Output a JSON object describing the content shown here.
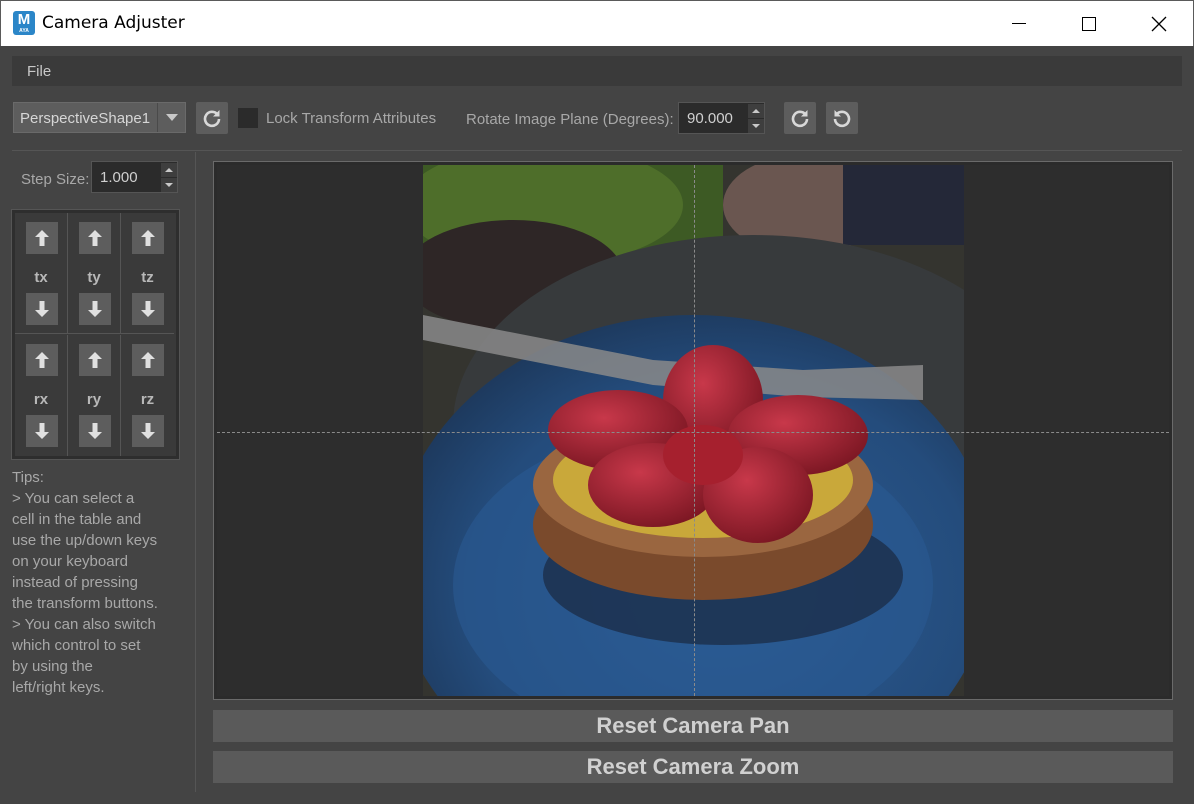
{
  "window": {
    "title": "Camera Adjuster",
    "icon_letter": "M",
    "icon_sub": "AYA"
  },
  "menu": {
    "file": "File"
  },
  "toolbar": {
    "camera_value": "PerspectiveShape1",
    "lock_label": "Lock Transform Attributes",
    "lock_checked": false,
    "rotate_label": "Rotate Image Plane (Degrees):",
    "rotate_value": "90.000"
  },
  "left_panel": {
    "step_label": "Step Size:",
    "step_value": "1.000",
    "transforms": [
      {
        "label": "tx"
      },
      {
        "label": "ty"
      },
      {
        "label": "tz"
      },
      {
        "label": "rx"
      },
      {
        "label": "ry"
      },
      {
        "label": "rz"
      }
    ],
    "tips": [
      "Tips:",
      "> You can select a",
      "cell in the table and",
      "use the up/down keys",
      "on your keyboard",
      "instead of pressing",
      "the transform buttons.",
      "> You can also switch",
      "which control to set",
      "by using the",
      "left/right keys."
    ]
  },
  "buttons": {
    "reset_pan": "Reset Camera Pan",
    "reset_zoom": "Reset Camera Zoom"
  },
  "icons": {
    "refresh": "refresh-icon",
    "undo": "undo-icon",
    "arrow_up": "arrow-up-icon",
    "arrow_down": "arrow-down-icon"
  },
  "colors": {
    "background": "#444444",
    "button": "#5d5d5d",
    "field": "#2b2b2b"
  }
}
